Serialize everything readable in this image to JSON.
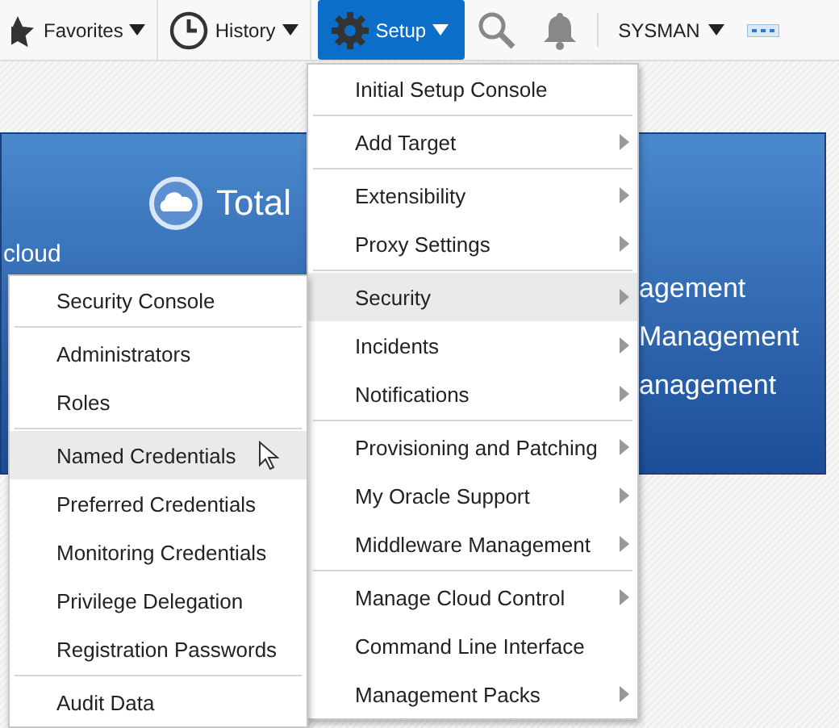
{
  "toolbar": {
    "items": [
      {
        "label": "Favorites",
        "selected": false
      },
      {
        "label": "History",
        "selected": false
      },
      {
        "label": "Setup",
        "selected": true
      }
    ],
    "user": "SYSMAN"
  },
  "banner": {
    "title": "Total",
    "side_text": "cloud",
    "lines": [
      "agement",
      "Management",
      "anagement"
    ]
  },
  "setup_menu": {
    "groups": [
      [
        {
          "label": "Initial Setup Console",
          "submenu": false,
          "selected": false
        }
      ],
      [
        {
          "label": "Add Target",
          "submenu": true,
          "selected": false
        }
      ],
      [
        {
          "label": "Extensibility",
          "submenu": true,
          "selected": false
        },
        {
          "label": "Proxy Settings",
          "submenu": true,
          "selected": false
        }
      ],
      [
        {
          "label": "Security",
          "submenu": true,
          "selected": true
        },
        {
          "label": "Incidents",
          "submenu": true,
          "selected": false
        },
        {
          "label": "Notifications",
          "submenu": true,
          "selected": false
        }
      ],
      [
        {
          "label": "Provisioning and Patching",
          "submenu": true,
          "selected": false
        },
        {
          "label": "My Oracle Support",
          "submenu": true,
          "selected": false
        },
        {
          "label": "Middleware Management",
          "submenu": true,
          "selected": false
        }
      ],
      [
        {
          "label": "Manage Cloud Control",
          "submenu": true,
          "selected": false
        },
        {
          "label": "Command Line Interface",
          "submenu": false,
          "selected": false
        },
        {
          "label": "Management Packs",
          "submenu": true,
          "selected": false
        }
      ]
    ]
  },
  "security_menu": {
    "groups": [
      [
        {
          "label": "Security Console",
          "submenu": false,
          "selected": false
        }
      ],
      [
        {
          "label": "Administrators",
          "submenu": false,
          "selected": false
        },
        {
          "label": "Roles",
          "submenu": false,
          "selected": false
        }
      ],
      [
        {
          "label": "Named Credentials",
          "submenu": false,
          "selected": true
        },
        {
          "label": "Preferred Credentials",
          "submenu": false,
          "selected": false
        },
        {
          "label": "Monitoring Credentials",
          "submenu": false,
          "selected": false
        },
        {
          "label": "Privilege Delegation",
          "submenu": false,
          "selected": false
        },
        {
          "label": "Registration Passwords",
          "submenu": false,
          "selected": false
        }
      ],
      [
        {
          "label": "Audit Data",
          "submenu": false,
          "selected": false
        }
      ]
    ]
  }
}
